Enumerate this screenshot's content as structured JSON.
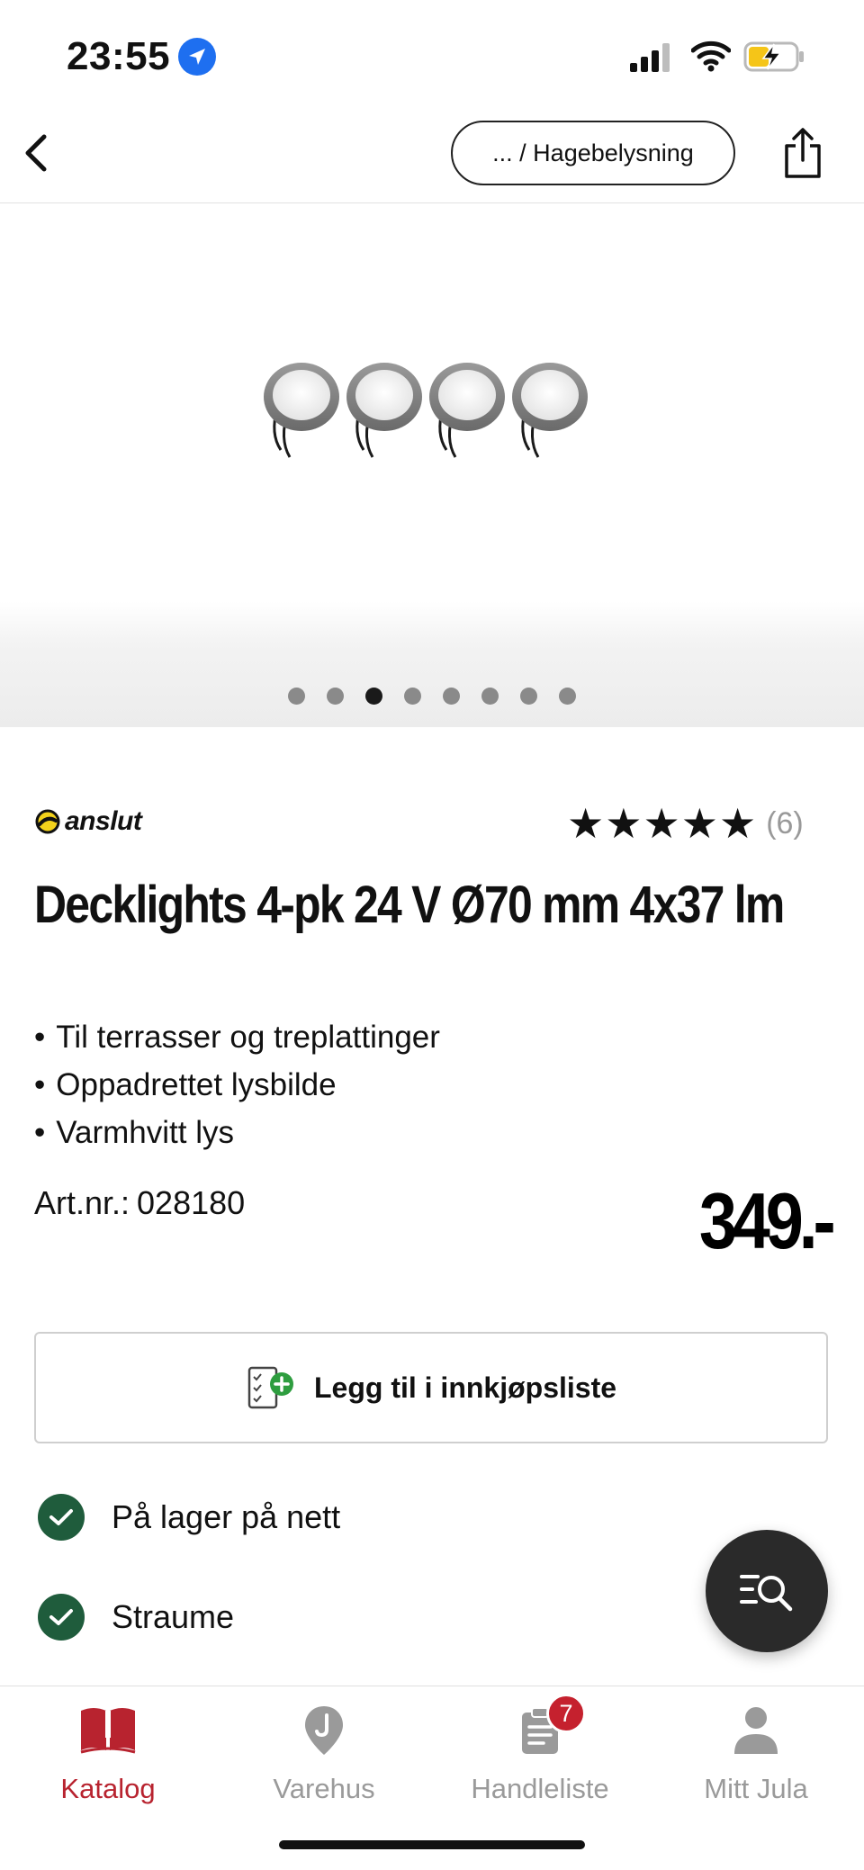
{
  "status_bar": {
    "time": "23:55"
  },
  "nav": {
    "breadcrumb": "... / Hagebelysning"
  },
  "gallery": {
    "image_count": 8,
    "active_index": 2
  },
  "product": {
    "brand": "anslut",
    "rating_stars": 5,
    "rating_count": "(6)",
    "title": "Decklights 4-pk 24 V Ø70 mm 4x37 lm",
    "bullets": [
      "Til terrasser og treplattinger",
      "Oppadrettet lysbilde",
      "Varmhvitt lys"
    ],
    "artnr_label": "Art.nr.:",
    "artnr_value": "028180",
    "price": "349.-"
  },
  "actions": {
    "add_to_list_label": "Legg til i innkjøpsliste"
  },
  "stock": [
    {
      "label": "På lager på nett"
    },
    {
      "label": "Straume"
    }
  ],
  "tabs": [
    {
      "label": "Katalog",
      "icon": "book-icon",
      "active": true
    },
    {
      "label": "Varehus",
      "icon": "map-pin-icon",
      "active": false
    },
    {
      "label": "Handleliste",
      "icon": "clipboard-icon",
      "active": false,
      "badge": "7"
    },
    {
      "label": "Mitt Jula",
      "icon": "person-icon",
      "active": false
    }
  ],
  "colors": {
    "accent": "#b8232f",
    "badge": "#c5212e",
    "stock_check": "#1f5c3c",
    "location_badge": "#1e6ff0",
    "fab": "#2a2a2a"
  }
}
